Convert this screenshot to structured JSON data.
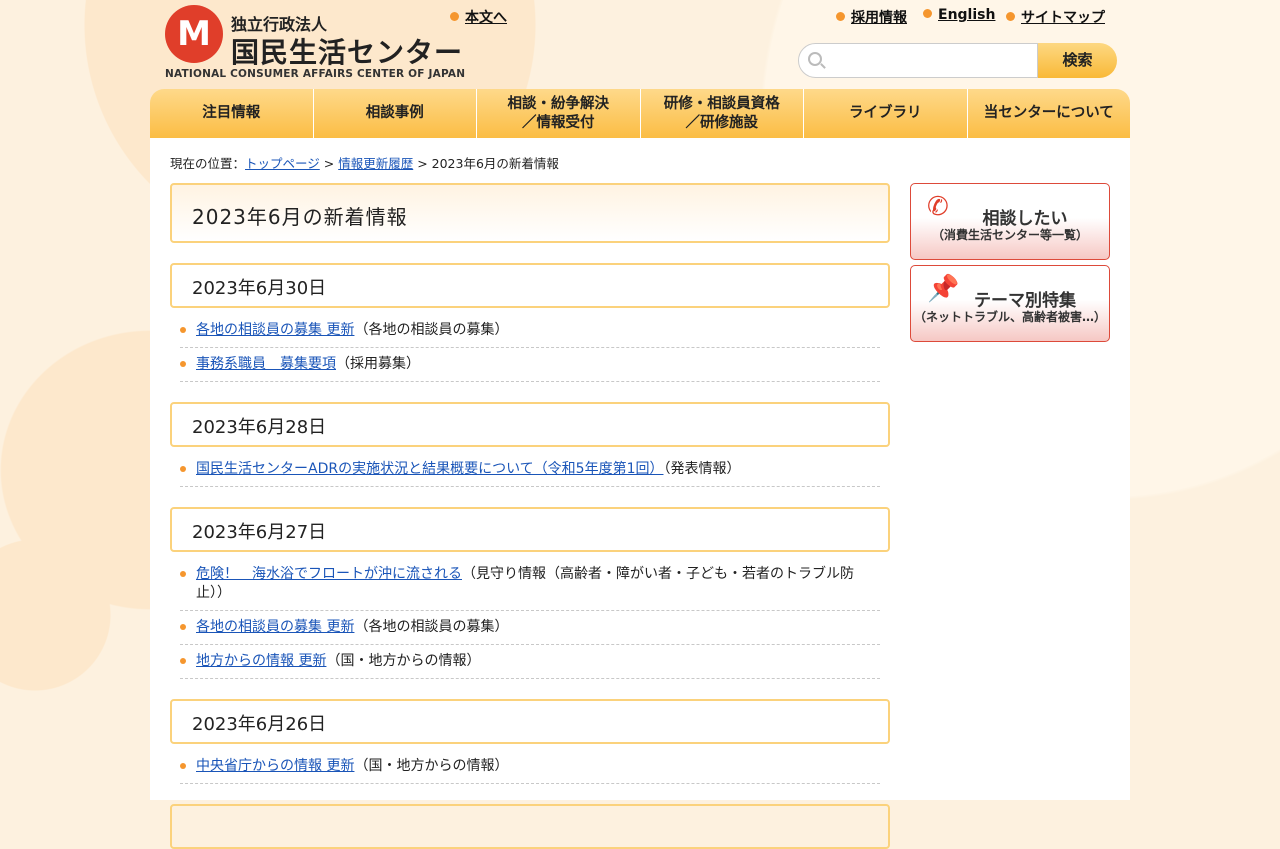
{
  "header": {
    "logo_sub": "独立行政法人",
    "logo_main": "国民生活センター",
    "logo_en": "NATIONAL CONSUMER AFFAIRS CENTER OF JAPAN",
    "skip_link": "本文へ",
    "links": [
      "採用情報",
      "English",
      "サイトマップ"
    ],
    "search_placeholder": "",
    "search_button": "検索"
  },
  "nav": [
    "注目情報",
    "相談事例",
    "相談・紛争解決\n／情報受付",
    "研修・相談員資格\n／研修施設",
    "ライブラリ",
    "当センターについて"
  ],
  "breadcrumb": {
    "prefix": "現在の位置：",
    "items": [
      "トップページ",
      "情報更新履歴"
    ],
    "current": "2023年6月の新着情報",
    "sep": " > "
  },
  "page_title": "2023年6月の新着情報",
  "sections": [
    {
      "date": "2023年6月30日",
      "items": [
        {
          "link": "各地の相談員の募集 更新",
          "note": "（各地の相談員の募集）"
        },
        {
          "link": "事務系職員　募集要項",
          "note": "（採用募集）"
        }
      ]
    },
    {
      "date": "2023年6月28日",
      "items": [
        {
          "link": "国民生活センターADRの実施状況と結果概要について（令和5年度第1回）",
          "note": "（発表情報）"
        }
      ]
    },
    {
      "date": "2023年6月27日",
      "items": [
        {
          "link": "危険！　海水浴でフロートが沖に流される",
          "note": "（見守り情報（高齢者・障がい者・子ども・若者のトラブル防止））"
        },
        {
          "link": "各地の相談員の募集 更新",
          "note": "（各地の相談員の募集）"
        },
        {
          "link": "地方からの情報 更新",
          "note": "（国・地方からの情報）"
        }
      ]
    },
    {
      "date": "2023年6月26日",
      "items": [
        {
          "link": "中央省庁からの情報 更新",
          "note": "（国・地方からの情報）"
        }
      ]
    }
  ],
  "sidebar": [
    {
      "title": "相談したい",
      "sub": "（消費生活センター等一覧）",
      "icon": "phone-icon"
    },
    {
      "title": "テーマ別特集",
      "sub": "（ネットトラブル、高齢者被害…）",
      "icon": "pushpin-icon"
    }
  ]
}
